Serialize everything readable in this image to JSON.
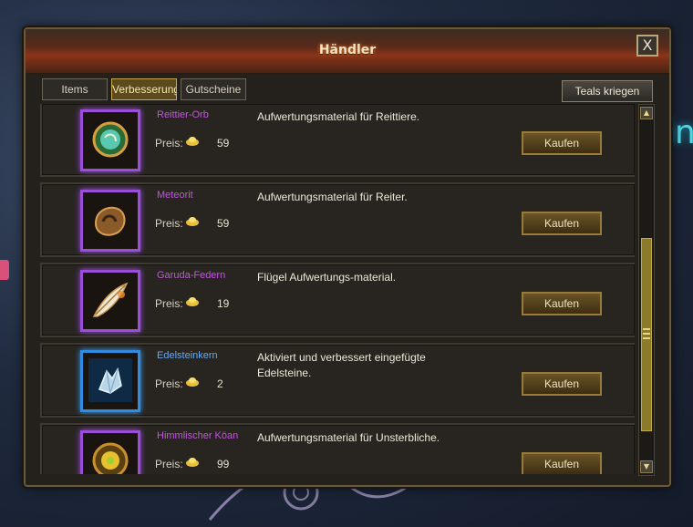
{
  "window": {
    "title": "Händler",
    "close_label": "X"
  },
  "tabs": [
    {
      "label": "Items",
      "active": false
    },
    {
      "label": "Verbesserungen",
      "active": true
    },
    {
      "label": "Gutscheine",
      "active": false
    }
  ],
  "teals_button": "Teals kriegen",
  "price_label": "Preis:",
  "buy_label": "Kaufen",
  "items": [
    {
      "name": "Reittier-Orb",
      "price": "59",
      "description": "Aufwertungsmaterial für Reittiere.",
      "icon": "orb-icon",
      "rarity_color": "#c455e0"
    },
    {
      "name": "Meteorit",
      "price": "59",
      "description": "Aufwertungsmaterial für Reiter.",
      "icon": "meteorite-icon",
      "rarity_color": "#c455e0"
    },
    {
      "name": "Garuda-Federn",
      "price": "19",
      "description": "Flügel Aufwertungs-material.",
      "icon": "feather-icon",
      "rarity_color": "#c455e0"
    },
    {
      "name": "Edelsteinkern",
      "price": "2",
      "description": "Aktiviert und verbessert eingefügte Edelsteine.",
      "icon": "crystal-icon",
      "rarity_color": "#6aa8f0"
    },
    {
      "name": "Himmlischer Köan",
      "price": "99",
      "description": "Aufwertungsmaterial für Unsterbliche.",
      "icon": "koan-orb-icon",
      "rarity_color": "#c455e0"
    }
  ],
  "colors": {
    "accent_gold": "#c8a650",
    "title_red": "#8a3418",
    "panel": "#24211c"
  }
}
